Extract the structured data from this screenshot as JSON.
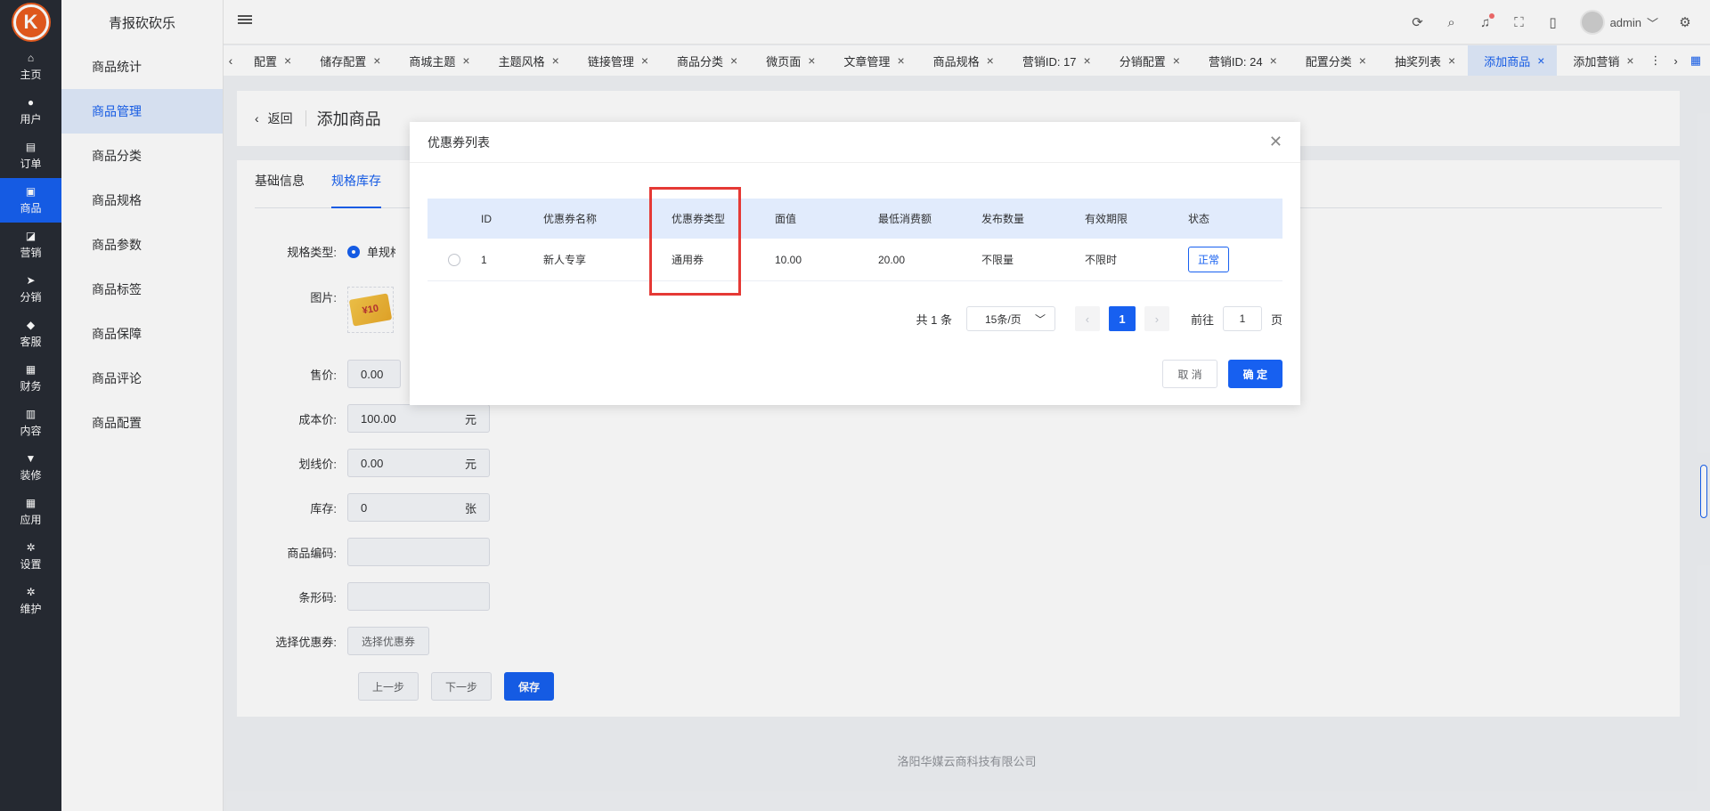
{
  "sidebar": {
    "logo": "K",
    "items": [
      {
        "label": "主页",
        "icon": "home-icon",
        "glyph": "⌂"
      },
      {
        "label": "用户",
        "icon": "user-icon",
        "glyph": "●"
      },
      {
        "label": "订单",
        "icon": "order-icon",
        "glyph": "▤"
      },
      {
        "label": "商品",
        "icon": "goods-icon",
        "glyph": "▣"
      },
      {
        "label": "营销",
        "icon": "marketing-icon",
        "glyph": "◪"
      },
      {
        "label": "分销",
        "icon": "distribution-icon",
        "glyph": "➤"
      },
      {
        "label": "客服",
        "icon": "service-icon",
        "glyph": "◆"
      },
      {
        "label": "财务",
        "icon": "finance-icon",
        "glyph": "▦"
      },
      {
        "label": "内容",
        "icon": "content-icon",
        "glyph": "▥"
      },
      {
        "label": "装修",
        "icon": "decorate-icon",
        "glyph": "▼"
      },
      {
        "label": "应用",
        "icon": "apps-icon",
        "glyph": "▦"
      },
      {
        "label": "设置",
        "icon": "settings-icon",
        "glyph": "✲"
      },
      {
        "label": "维护",
        "icon": "maintenance-icon",
        "glyph": "✲"
      }
    ]
  },
  "submenu": {
    "title": "青报砍砍乐",
    "items": [
      "商品统计",
      "商品管理",
      "商品分类",
      "商品规格",
      "商品参数",
      "商品标签",
      "商品保障",
      "商品评论",
      "商品配置"
    ]
  },
  "header": {
    "user": "admin"
  },
  "tabs": [
    "配置",
    "储存配置",
    "商城主题",
    "主题风格",
    "链接管理",
    "商品分类",
    "微页面",
    "文章管理",
    "商品规格",
    "营销ID: 17",
    "分销配置",
    "营销ID: 24",
    "配置分类",
    "抽奖列表",
    "添加商品",
    "添加营销"
  ],
  "page": {
    "back": "返回",
    "title": "添加商品",
    "form_tabs": [
      "基础信息",
      "规格库存"
    ],
    "spec_type_label": "规格类型:",
    "spec_type_value": "单规格",
    "image_label": "图片:",
    "coupon_img_text": "¥10",
    "price_label": "售价:",
    "price_value": "0.00",
    "cost_label": "成本价:",
    "cost_value": "100.00",
    "cost_unit": "元",
    "line_label": "划线价:",
    "line_value": "0.00",
    "line_unit": "元",
    "stock_label": "库存:",
    "stock_value": "0",
    "stock_unit": "张",
    "code_label": "商品编码:",
    "barcode_label": "条形码:",
    "coupon_label": "选择优惠券:",
    "coupon_btn": "选择优惠券",
    "prev_btn": "上一步",
    "next_btn": "下一步",
    "save_btn": "保存"
  },
  "footer": "洛阳华媒云商科技有限公司",
  "dialog": {
    "title": "优惠券列表",
    "columns": [
      "ID",
      "优惠券名称",
      "优惠券类型",
      "面值",
      "最低消费额",
      "发布数量",
      "有效期限",
      "状态"
    ],
    "rows": [
      {
        "id": "1",
        "name": "新人专享",
        "type": "通用券",
        "value": "10.00",
        "min": "20.00",
        "count": "不限量",
        "expire": "不限时",
        "status": "正常"
      }
    ],
    "pager": {
      "total": "共 1 条",
      "page_size": "15条/页",
      "current": "1",
      "goto_label": "前往",
      "goto_value": "1",
      "page_unit": "页"
    },
    "cancel": "取 消",
    "confirm": "确 定"
  }
}
